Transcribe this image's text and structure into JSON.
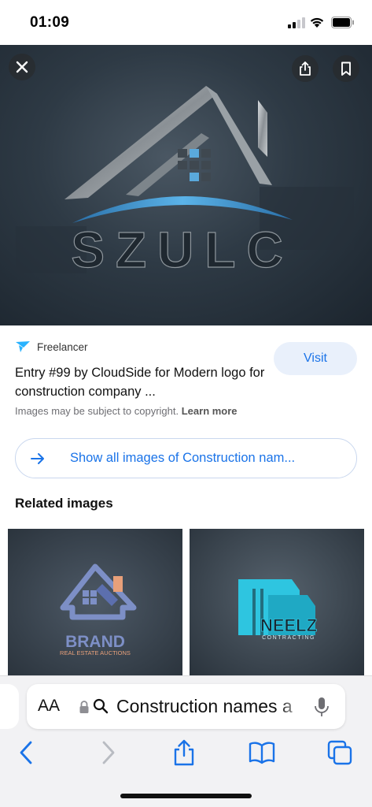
{
  "status_bar": {
    "time": "01:09"
  },
  "hero": {
    "logo_text": "SZULC",
    "close_icon": "close-icon",
    "share_icon": "share-icon",
    "bookmark_icon": "bookmark-icon"
  },
  "result": {
    "source": "Freelancer",
    "title": "Entry #99 by CloudSide for Modern logo for construction company ...",
    "copyright_text": "Images may be subject to copyright.",
    "learn_more": "Learn more",
    "visit_label": "Visit"
  },
  "show_all": {
    "label": "Show all images of Construction nam..."
  },
  "related": {
    "heading": "Related images",
    "items": [
      {
        "logo_text": "BRAND",
        "tagline": "REAL ESTATE AUCTIONS"
      },
      {
        "logo_text": "NEELZ",
        "tagline": "CONTRACTING"
      }
    ]
  },
  "address_bar": {
    "aa_label": "AA",
    "query": "Construction names a"
  },
  "colors": {
    "accent": "#1a73e8",
    "visit_bg": "#e9f0fb",
    "logo_blue": "#4aa3df",
    "cyan": "#2ec5e0"
  }
}
